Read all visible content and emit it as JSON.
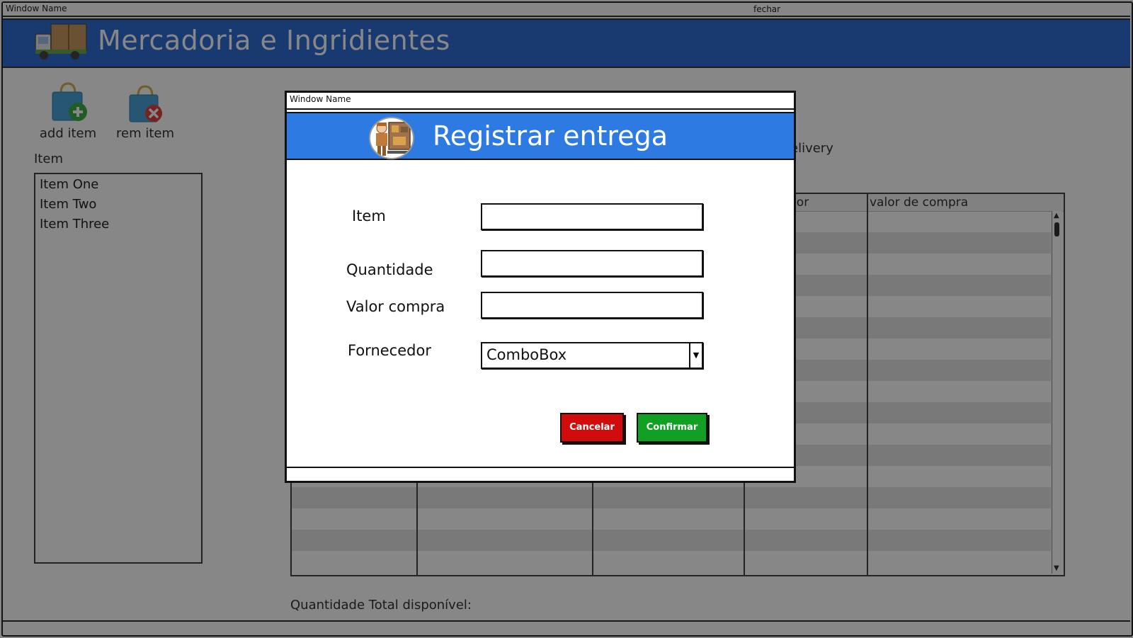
{
  "window": {
    "title": "Window Name",
    "close_label": "fechar"
  },
  "header": {
    "title": "Mercadoria e Ingridientes",
    "icon": "truck-icon",
    "band_color": "#2f6fd6"
  },
  "toolbar": {
    "add_label": "add item",
    "add_icon": "shopping-bag-add-icon",
    "remove_label": "rem item",
    "remove_icon": "shopping-bag-remove-icon"
  },
  "item_list": {
    "label": "Item",
    "items": [
      "Item One",
      "Item Two",
      "Item Three"
    ]
  },
  "partial_label": "elivery",
  "table": {
    "columns": [
      "",
      "",
      "",
      "dor",
      "valor de compra"
    ]
  },
  "footer": {
    "total_label": "Quantidade Total disponível:"
  },
  "modal": {
    "window_title": "Window Name",
    "title": "Registrar entrega",
    "header_color": "#2d7ae3",
    "avatar_icon": "delivery-person-icon",
    "fields": {
      "item_label": "Item",
      "item_value": "",
      "quantidade_label": "Quantidade",
      "quantidade_value": "",
      "valor_label": "Valor compra",
      "valor_value": "",
      "fornecedor_label": "Fornecedor",
      "fornecedor_value": "ComboBox"
    },
    "buttons": {
      "cancel_label": "Cancelar",
      "cancel_color": "#d00c0c",
      "confirm_label": "Confirmar",
      "confirm_color": "#12a024"
    }
  }
}
